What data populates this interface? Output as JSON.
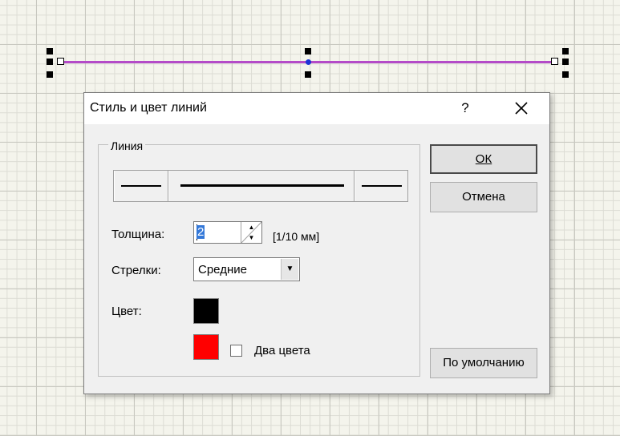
{
  "canvas": {
    "line_color": "#b44bc8",
    "handle_color": "#000000",
    "midpoint_color": "#1c34d6"
  },
  "dialog": {
    "title": "Стиль и цвет линий",
    "help_label": "?",
    "close_icon": "close-icon",
    "line_group": {
      "label": "Линия",
      "styles": [
        "short-left",
        "long-center",
        "short-right"
      ]
    },
    "thickness": {
      "label": "Толщина:",
      "value": "2",
      "unit": "[1/10 мм]"
    },
    "arrows": {
      "label": "Стрелки:",
      "selected": "Средние"
    },
    "color": {
      "label": "Цвет:",
      "primary": "#000000",
      "secondary": "#ff0000"
    },
    "two_colors": {
      "label": "Два цвета",
      "checked": false
    },
    "buttons": {
      "ok": "ОК",
      "cancel": "Отмена",
      "default": "По умолчанию"
    }
  }
}
